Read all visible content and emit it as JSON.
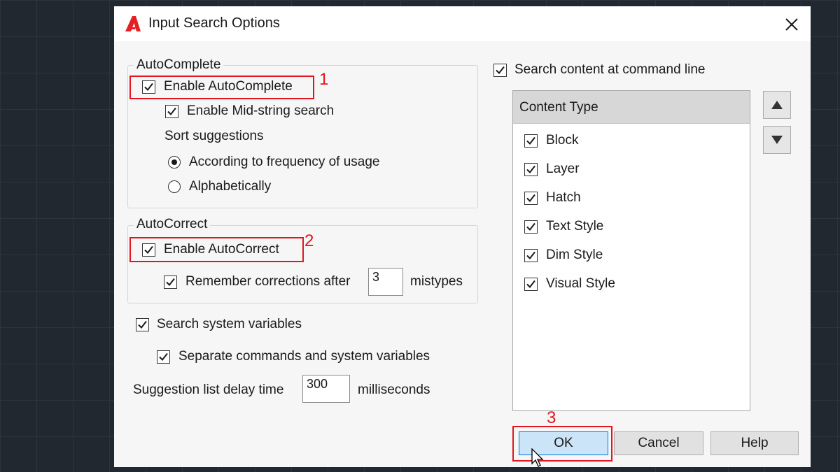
{
  "dialog": {
    "title": "Input Search Options",
    "app_icon": "autocad-a-icon",
    "close_icon": "close-icon"
  },
  "autocomplete": {
    "legend": "AutoComplete",
    "enable_label": "Enable AutoComplete",
    "enable_checked": true,
    "midstring_label": "Enable Mid-string search",
    "midstring_checked": true,
    "sort_label": "Sort suggestions",
    "sort_options": [
      "According to frequency of usage",
      "Alphabetically"
    ],
    "sort_selected": "According to frequency of usage"
  },
  "autocorrect": {
    "legend": "AutoCorrect",
    "enable_label": "Enable AutoCorrect",
    "enable_checked": true,
    "remember_label": "Remember corrections after",
    "remember_checked": true,
    "remember_value": "3",
    "remember_suffix": "mistypes"
  },
  "system_vars": {
    "search_label": "Search system variables",
    "search_checked": true,
    "separate_label": "Separate commands and system variables",
    "separate_checked": true
  },
  "delay": {
    "label": "Suggestion list delay time",
    "value": "300",
    "unit": "milliseconds"
  },
  "content": {
    "search_label": "Search content at command line",
    "search_checked": true,
    "header": "Content Type",
    "items": [
      {
        "label": "Block",
        "checked": true
      },
      {
        "label": "Layer",
        "checked": true
      },
      {
        "label": "Hatch",
        "checked": true
      },
      {
        "label": "Text Style",
        "checked": true
      },
      {
        "label": "Dim Style",
        "checked": true
      },
      {
        "label": "Visual Style",
        "checked": true
      }
    ],
    "move_up_icon": "triangle-up-icon",
    "move_down_icon": "triangle-down-icon"
  },
  "buttons": {
    "ok": "OK",
    "cancel": "Cancel",
    "help": "Help"
  },
  "annotations": {
    "marker_1": "1",
    "marker_2": "2",
    "marker_3": "3",
    "highlight_color": "#e3161f"
  },
  "colors": {
    "accent": "#0078d7",
    "ok_fill": "#cce4f7",
    "brand_red": "#e51f23"
  }
}
